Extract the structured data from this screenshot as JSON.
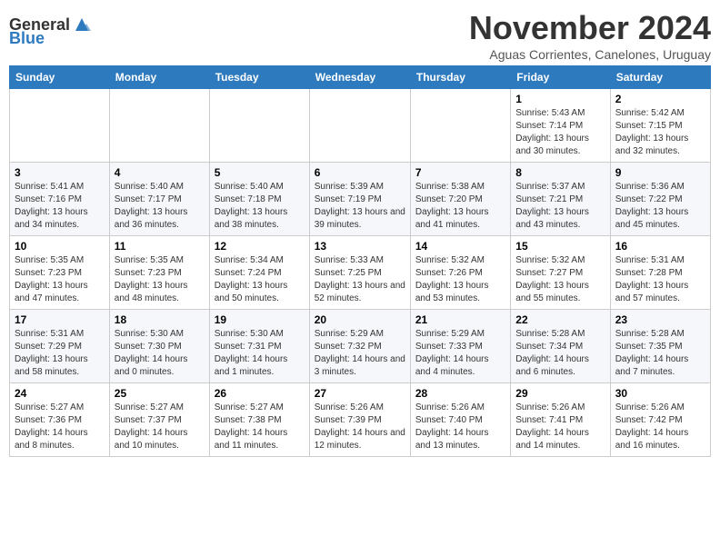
{
  "logo": {
    "text_general": "General",
    "text_blue": "Blue"
  },
  "title": "November 2024",
  "subtitle": "Aguas Corrientes, Canelones, Uruguay",
  "weekdays": [
    "Sunday",
    "Monday",
    "Tuesday",
    "Wednesday",
    "Thursday",
    "Friday",
    "Saturday"
  ],
  "weeks": [
    [
      {
        "day": "",
        "info": ""
      },
      {
        "day": "",
        "info": ""
      },
      {
        "day": "",
        "info": ""
      },
      {
        "day": "",
        "info": ""
      },
      {
        "day": "",
        "info": ""
      },
      {
        "day": "1",
        "info": "Sunrise: 5:43 AM\nSunset: 7:14 PM\nDaylight: 13 hours and 30 minutes."
      },
      {
        "day": "2",
        "info": "Sunrise: 5:42 AM\nSunset: 7:15 PM\nDaylight: 13 hours and 32 minutes."
      }
    ],
    [
      {
        "day": "3",
        "info": "Sunrise: 5:41 AM\nSunset: 7:16 PM\nDaylight: 13 hours and 34 minutes."
      },
      {
        "day": "4",
        "info": "Sunrise: 5:40 AM\nSunset: 7:17 PM\nDaylight: 13 hours and 36 minutes."
      },
      {
        "day": "5",
        "info": "Sunrise: 5:40 AM\nSunset: 7:18 PM\nDaylight: 13 hours and 38 minutes."
      },
      {
        "day": "6",
        "info": "Sunrise: 5:39 AM\nSunset: 7:19 PM\nDaylight: 13 hours and 39 minutes."
      },
      {
        "day": "7",
        "info": "Sunrise: 5:38 AM\nSunset: 7:20 PM\nDaylight: 13 hours and 41 minutes."
      },
      {
        "day": "8",
        "info": "Sunrise: 5:37 AM\nSunset: 7:21 PM\nDaylight: 13 hours and 43 minutes."
      },
      {
        "day": "9",
        "info": "Sunrise: 5:36 AM\nSunset: 7:22 PM\nDaylight: 13 hours and 45 minutes."
      }
    ],
    [
      {
        "day": "10",
        "info": "Sunrise: 5:35 AM\nSunset: 7:23 PM\nDaylight: 13 hours and 47 minutes."
      },
      {
        "day": "11",
        "info": "Sunrise: 5:35 AM\nSunset: 7:23 PM\nDaylight: 13 hours and 48 minutes."
      },
      {
        "day": "12",
        "info": "Sunrise: 5:34 AM\nSunset: 7:24 PM\nDaylight: 13 hours and 50 minutes."
      },
      {
        "day": "13",
        "info": "Sunrise: 5:33 AM\nSunset: 7:25 PM\nDaylight: 13 hours and 52 minutes."
      },
      {
        "day": "14",
        "info": "Sunrise: 5:32 AM\nSunset: 7:26 PM\nDaylight: 13 hours and 53 minutes."
      },
      {
        "day": "15",
        "info": "Sunrise: 5:32 AM\nSunset: 7:27 PM\nDaylight: 13 hours and 55 minutes."
      },
      {
        "day": "16",
        "info": "Sunrise: 5:31 AM\nSunset: 7:28 PM\nDaylight: 13 hours and 57 minutes."
      }
    ],
    [
      {
        "day": "17",
        "info": "Sunrise: 5:31 AM\nSunset: 7:29 PM\nDaylight: 13 hours and 58 minutes."
      },
      {
        "day": "18",
        "info": "Sunrise: 5:30 AM\nSunset: 7:30 PM\nDaylight: 14 hours and 0 minutes."
      },
      {
        "day": "19",
        "info": "Sunrise: 5:30 AM\nSunset: 7:31 PM\nDaylight: 14 hours and 1 minutes."
      },
      {
        "day": "20",
        "info": "Sunrise: 5:29 AM\nSunset: 7:32 PM\nDaylight: 14 hours and 3 minutes."
      },
      {
        "day": "21",
        "info": "Sunrise: 5:29 AM\nSunset: 7:33 PM\nDaylight: 14 hours and 4 minutes."
      },
      {
        "day": "22",
        "info": "Sunrise: 5:28 AM\nSunset: 7:34 PM\nDaylight: 14 hours and 6 minutes."
      },
      {
        "day": "23",
        "info": "Sunrise: 5:28 AM\nSunset: 7:35 PM\nDaylight: 14 hours and 7 minutes."
      }
    ],
    [
      {
        "day": "24",
        "info": "Sunrise: 5:27 AM\nSunset: 7:36 PM\nDaylight: 14 hours and 8 minutes."
      },
      {
        "day": "25",
        "info": "Sunrise: 5:27 AM\nSunset: 7:37 PM\nDaylight: 14 hours and 10 minutes."
      },
      {
        "day": "26",
        "info": "Sunrise: 5:27 AM\nSunset: 7:38 PM\nDaylight: 14 hours and 11 minutes."
      },
      {
        "day": "27",
        "info": "Sunrise: 5:26 AM\nSunset: 7:39 PM\nDaylight: 14 hours and 12 minutes."
      },
      {
        "day": "28",
        "info": "Sunrise: 5:26 AM\nSunset: 7:40 PM\nDaylight: 14 hours and 13 minutes."
      },
      {
        "day": "29",
        "info": "Sunrise: 5:26 AM\nSunset: 7:41 PM\nDaylight: 14 hours and 14 minutes."
      },
      {
        "day": "30",
        "info": "Sunrise: 5:26 AM\nSunset: 7:42 PM\nDaylight: 14 hours and 16 minutes."
      }
    ]
  ]
}
